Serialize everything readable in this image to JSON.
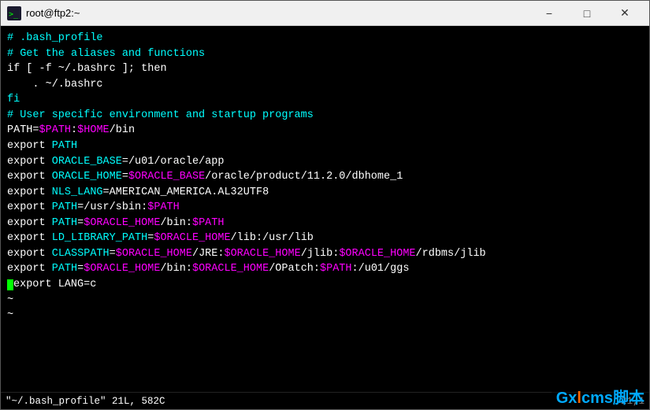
{
  "window": {
    "title": "root@ftp2:~",
    "icon": "terminal"
  },
  "titlebar": {
    "minimize": "−",
    "restore": "□",
    "close": "✕"
  },
  "terminal": {
    "lines": [
      {
        "text": "# .bash_profile",
        "color": "cyan"
      },
      {
        "text": "",
        "color": "white"
      },
      {
        "text": "# Get the aliases and functions",
        "color": "cyan"
      },
      {
        "text": "if [ -f ~/.bashrc ]; then",
        "color": "white"
      },
      {
        "text": "    . ~/.bashrc",
        "color": "white"
      },
      {
        "text": "fi",
        "color": "white"
      },
      {
        "text": "",
        "color": "white"
      },
      {
        "text": "# User specific environment and startup programs",
        "color": "cyan"
      },
      {
        "text": "",
        "color": "white"
      },
      {
        "text": "PATH=$PATH:$HOME/bin",
        "color": "white"
      },
      {
        "text": "",
        "color": "white"
      },
      {
        "text": "export PATH",
        "color": "white"
      },
      {
        "text": "export ORACLE_BASE=/u01/oracle/app",
        "color": "white"
      },
      {
        "text": "export ORACLE_HOME=$ORACLE_BASE/oracle/product/11.2.0/dbhome_1",
        "color": "white"
      },
      {
        "text": "export NLS_LANG=AMERICAN_AMERICA.AL32UTF8",
        "color": "white"
      },
      {
        "text": "export PATH=/usr/sbin:$PATH",
        "color": "white"
      },
      {
        "text": "export PATH=$ORACLE_HOME/bin:$PATH",
        "color": "white"
      },
      {
        "text": "export LD_LIBRARY_PATH=$ORACLE_HOME/lib:/usr/lib",
        "color": "white"
      },
      {
        "text": "export CLASSPATH=$ORACLE_HOME/JRE:$ORACLE_HOME/jlib:$ORACLE_HOME/rdbms/jlib",
        "color": "white"
      },
      {
        "text": "export PATH=$ORACLE_HOME/bin:$ORACLE_HOME/OPatch:$PATH:/u01/ggs",
        "color": "white"
      },
      {
        "text": "export LANG=c",
        "color": "white"
      },
      {
        "text": "~",
        "color": "white"
      },
      {
        "text": "~",
        "color": "white"
      }
    ]
  },
  "statusbar": {
    "left": "\"~/.bash_profile\" 21L, 582C",
    "right": "21,1"
  },
  "watermark": {
    "text": "Gxlcms脚本"
  }
}
